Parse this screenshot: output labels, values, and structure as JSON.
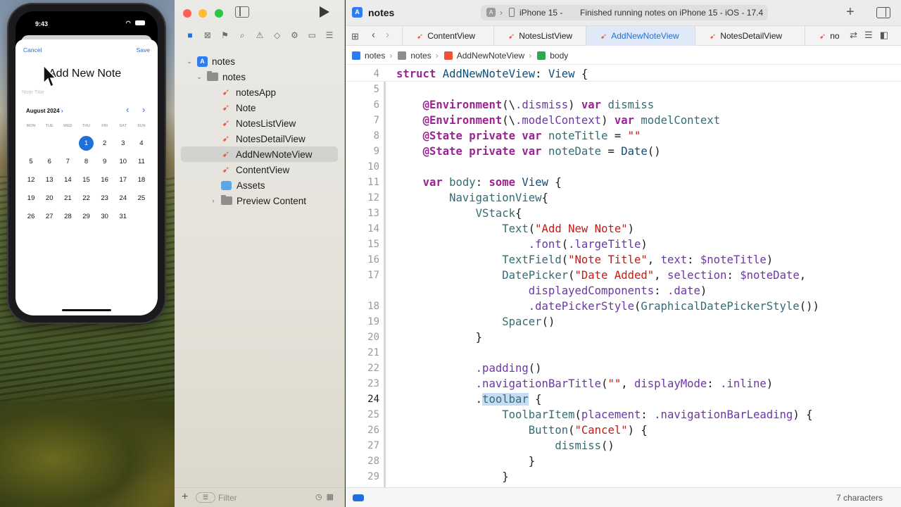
{
  "simulator": {
    "time": "9:43",
    "cancel_label": "Cancel",
    "save_label": "Save",
    "title": "Add New Note",
    "note_placeholder": "Note Title",
    "month_label": "August 2024",
    "weekdays": [
      "MON",
      "TUE",
      "WED",
      "THU",
      "FRI",
      "SAT",
      "SUN"
    ],
    "days": [
      "",
      "",
      "",
      "1",
      "2",
      "3",
      "4",
      "5",
      "6",
      "7",
      "8",
      "9",
      "10",
      "11",
      "12",
      "13",
      "14",
      "15",
      "16",
      "17",
      "18",
      "19",
      "20",
      "21",
      "22",
      "23",
      "24",
      "25",
      "26",
      "27",
      "28",
      "29",
      "30",
      "31"
    ],
    "selected_day": "1",
    "accent_color": "#1f6fdc"
  },
  "navigator": {
    "tree": [
      {
        "label": "notes",
        "icon": "app-icon",
        "indent": 0,
        "disclosure": "open"
      },
      {
        "label": "notes",
        "icon": "folder-icon",
        "indent": 1,
        "disclosure": "open"
      },
      {
        "label": "notesApp",
        "icon": "swift-file-icon",
        "indent": 2
      },
      {
        "label": "Note",
        "icon": "swift-file-icon",
        "indent": 2
      },
      {
        "label": "NotesListView",
        "icon": "swift-file-icon",
        "indent": 2
      },
      {
        "label": "NotesDetailView",
        "icon": "swift-file-icon",
        "indent": 2
      },
      {
        "label": "AddNewNoteView",
        "icon": "swift-file-icon",
        "indent": 2,
        "selected": true
      },
      {
        "label": "ContentView",
        "icon": "swift-file-icon",
        "indent": 2
      },
      {
        "label": "Assets",
        "icon": "asset-catalog-icon",
        "indent": 2
      },
      {
        "label": "Preview Content",
        "icon": "folder-icon",
        "indent": 2,
        "disclosure": "closed"
      }
    ],
    "filter_placeholder": "Filter"
  },
  "toolbar": {
    "project_name": "notes",
    "device": "iPhone 15 -",
    "status": "Finished running notes on iPhone 15 - iOS - 17.4"
  },
  "tabs": [
    {
      "label": "ContentView",
      "active": false
    },
    {
      "label": "NotesListView",
      "active": false
    },
    {
      "label": "AddNewNoteView",
      "active": true
    },
    {
      "label": "NotesDetailView",
      "active": false
    },
    {
      "label": "no",
      "active": false
    }
  ],
  "jumpbar": {
    "crumbs": [
      "notes",
      "notes",
      "AddNewNoteView",
      "body"
    ]
  },
  "code_lines": [
    {
      "n": "4",
      "text": "struct AddNewNoteView: View {",
      "sticky": true
    },
    {
      "n": "5",
      "text": ""
    },
    {
      "n": "6",
      "text": "    @Environment(\\.dismiss) var dismiss"
    },
    {
      "n": "7",
      "text": "    @Environment(\\.modelContext) var modelContext"
    },
    {
      "n": "8",
      "text": "    @State private var noteTitle = \"\""
    },
    {
      "n": "9",
      "text": "    @State private var noteDate = Date()"
    },
    {
      "n": "10",
      "text": ""
    },
    {
      "n": "11",
      "text": "    var body: some View {"
    },
    {
      "n": "12",
      "text": "        NavigationView{"
    },
    {
      "n": "13",
      "text": "            VStack{"
    },
    {
      "n": "14",
      "text": "                Text(\"Add New Note\")"
    },
    {
      "n": "15",
      "text": "                    .font(.largeTitle)"
    },
    {
      "n": "16",
      "text": "                TextField(\"Note Title\", text: $noteTitle)"
    },
    {
      "n": "17",
      "text": "                DatePicker(\"Date Added\", selection: $noteDate,"
    },
    {
      "n": "",
      "text": "                    displayedComponents: .date)"
    },
    {
      "n": "18",
      "text": "                    .datePickerStyle(GraphicalDatePickerStyle())"
    },
    {
      "n": "19",
      "text": "                Spacer()"
    },
    {
      "n": "20",
      "text": "            }"
    },
    {
      "n": "21",
      "text": ""
    },
    {
      "n": "22",
      "text": "            .padding()"
    },
    {
      "n": "23",
      "text": "            .navigationBarTitle(\"\", displayMode: .inline)"
    },
    {
      "n": "24",
      "text": "            .toolbar {",
      "current": true
    },
    {
      "n": "25",
      "text": "                ToolbarItem(placement: .navigationBarLeading) {"
    },
    {
      "n": "26",
      "text": "                    Button(\"Cancel\") {"
    },
    {
      "n": "27",
      "text": "                        dismiss()"
    },
    {
      "n": "28",
      "text": "                    }"
    },
    {
      "n": "29",
      "text": "                }"
    }
  ],
  "bottom_status": {
    "selection": "7 characters"
  }
}
